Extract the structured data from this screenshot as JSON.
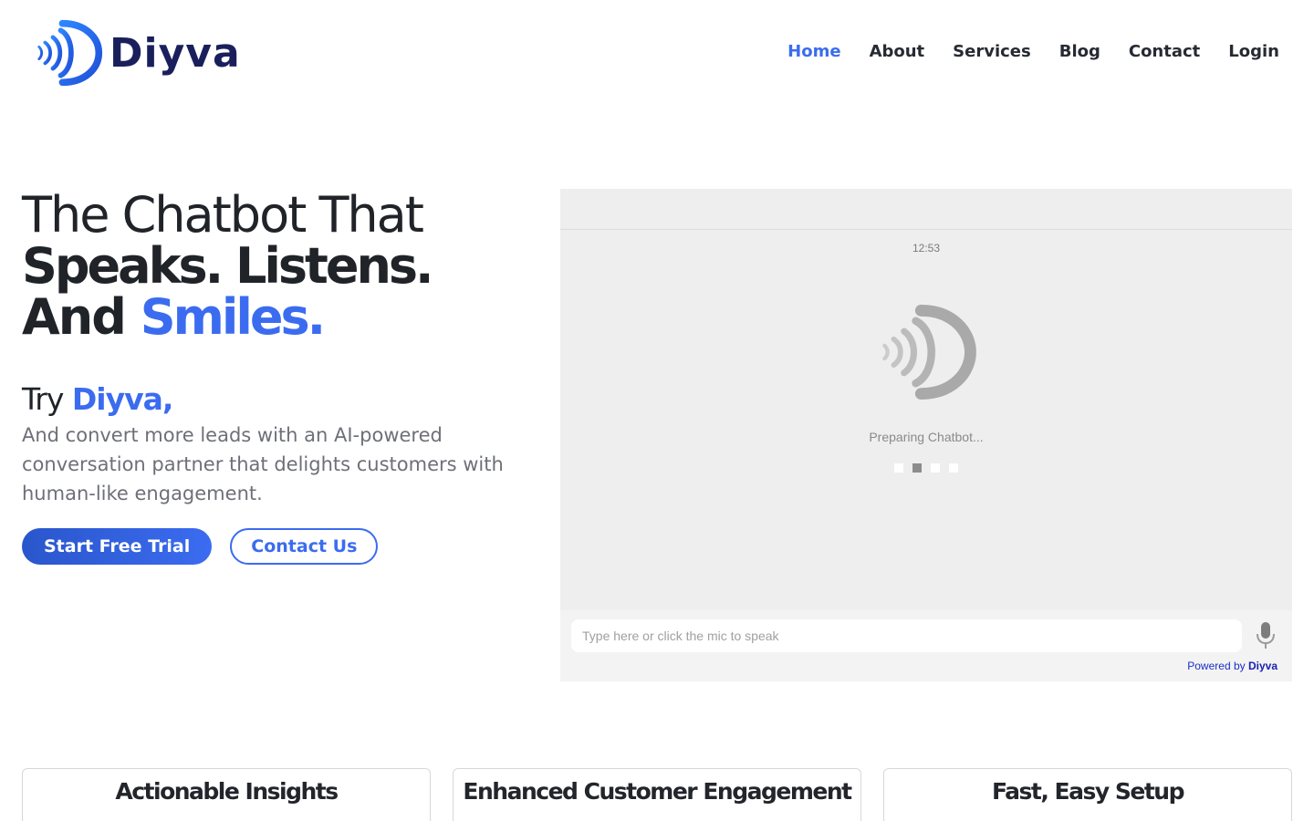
{
  "brand": {
    "name": "Diyva",
    "logo_icon": "diyva-soundwave-logo",
    "color": "#3b6cf0",
    "dark": "#1a1f5c"
  },
  "nav": {
    "items": [
      {
        "label": "Home",
        "active": true
      },
      {
        "label": "About"
      },
      {
        "label": "Services"
      },
      {
        "label": "Blog"
      },
      {
        "label": "Contact"
      },
      {
        "label": "Login"
      }
    ]
  },
  "hero": {
    "line1": "The Chatbot That",
    "line2": "Speaks. Listens.",
    "line3_prefix": "And",
    "line3_highlight": "Smiles.",
    "try_prefix": "Try",
    "try_highlight": "Diyva,",
    "description": "And convert more leads with an AI-powered conversation partner that delights customers with human-like engagement.",
    "primary_cta": "Start Free Trial",
    "secondary_cta": "Contact Us"
  },
  "chat": {
    "time": "12:53",
    "status": "Preparing Chatbot...",
    "loading_dots": 4,
    "active_dot": 2,
    "input_placeholder": "Type here or click the mic to speak",
    "powered_prefix": "Powered by",
    "powered_brand": "Diyva",
    "mic_icon": "microphone-icon"
  },
  "features": [
    {
      "title": "Actionable Insights"
    },
    {
      "title": "Enhanced Customer Engagement"
    },
    {
      "title": "Fast, Easy Setup"
    }
  ]
}
